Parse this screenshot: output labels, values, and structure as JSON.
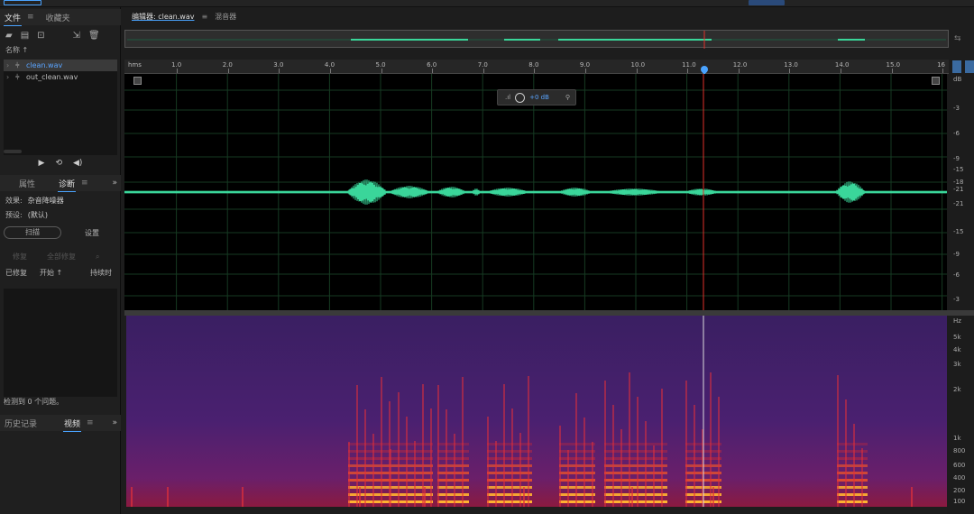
{
  "files_panel": {
    "tabs": [
      "文件",
      "收藏夹"
    ],
    "column_header": "名称 ↑",
    "files": [
      {
        "name": "clean.wav",
        "selected": true
      },
      {
        "name": "out_clean.wav",
        "selected": false
      }
    ],
    "transport_icons": [
      "play-icon",
      "loop-icon",
      "speaker-icon"
    ]
  },
  "diagnostics_panel": {
    "tabs": [
      "属性",
      "诊断"
    ],
    "effect_label": "效果:",
    "effect_value": "杂音降噪器",
    "preset_label": "预设:",
    "preset_value": "(默认)",
    "scan_button": "扫描",
    "settings_button": "设置",
    "repair_button": "修复",
    "repair_all_button": "全部修复",
    "columns": [
      "已修复",
      "开始 ↑",
      "持续时"
    ],
    "status": "检测到 0 个问题。"
  },
  "bottom_panel": {
    "tabs": [
      "历史记录",
      "视频"
    ]
  },
  "editor": {
    "tabs": [
      "编辑器: clean.wav",
      "混音器"
    ],
    "ruler_unit": "hms",
    "ruler_ticks": [
      "1.0",
      "2.0",
      "3.0",
      "4.0",
      "5.0",
      "6.0",
      "7.0",
      "8.0",
      "9.0",
      "10.0",
      "11.0",
      "12.0",
      "13.0",
      "14.0",
      "15.0",
      "16"
    ],
    "hud_volume": "+0 dB",
    "db_scale": [
      "dB",
      "-3",
      "-6",
      "-9",
      "-15",
      "-18",
      "-21",
      "-21",
      "-15",
      "-9",
      "-6",
      "-3"
    ],
    "hz_scale": [
      "Hz",
      "5k",
      "4k",
      "3k",
      "2k",
      "1k",
      "800",
      "600",
      "400",
      "200",
      "100"
    ]
  },
  "colors": {
    "waveform": "#3ad69a",
    "playhead": "#e0302a",
    "accent": "#4aa3ff"
  }
}
